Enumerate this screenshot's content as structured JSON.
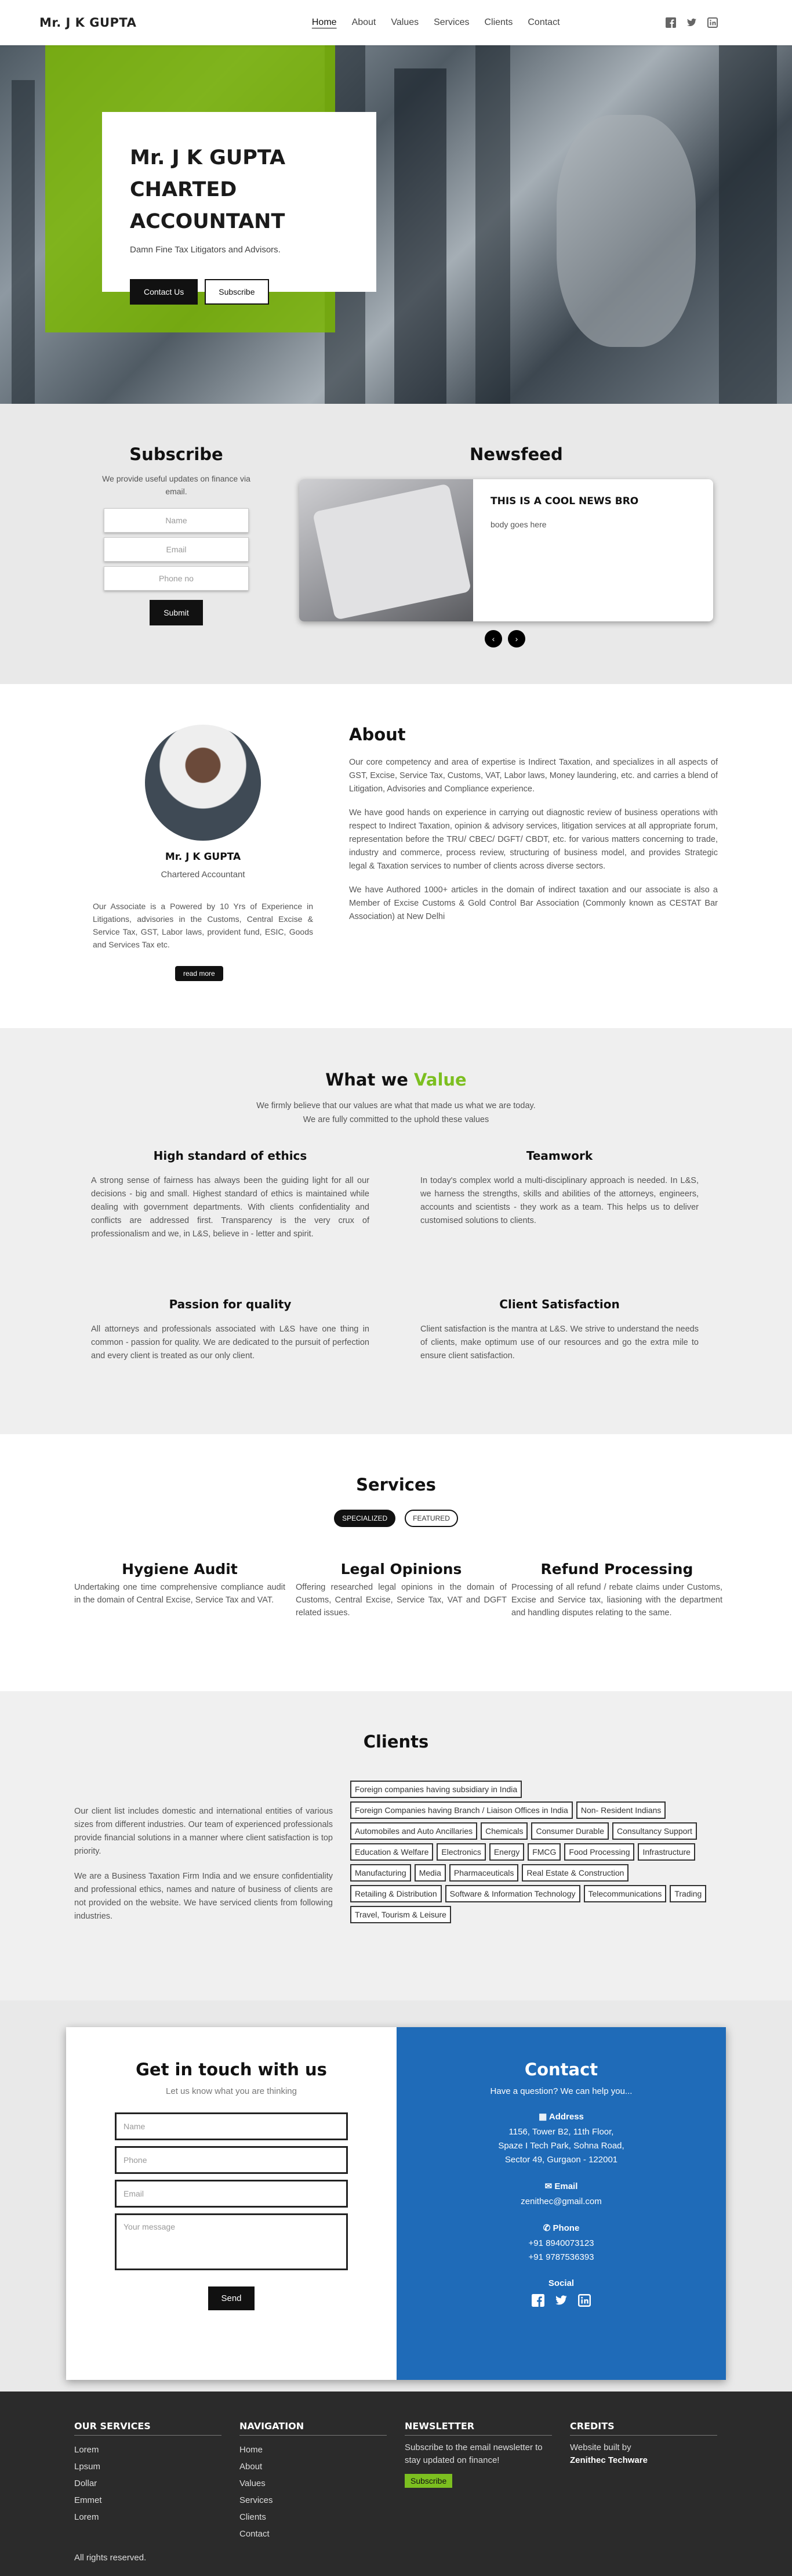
{
  "nav": {
    "brand": "Mr. J K GUPTA",
    "links": [
      "Home",
      "About",
      "Values",
      "Services",
      "Clients",
      "Contact"
    ],
    "social_icons": [
      "facebook-icon",
      "twitter-icon",
      "linkedin-icon"
    ]
  },
  "hero": {
    "title_line1": "Mr. J K GUPTA",
    "title_line2": "CHARTED ACCOUNTANT",
    "tagline": "Damn Fine Tax Litigators and Advisors.",
    "contact_button": "Contact Us",
    "subscribe_button": "Subscribe",
    "accent_color": "#7cbf20"
  },
  "subscribe": {
    "heading": "Subscribe",
    "text": "We provide useful updates on finance via email.",
    "name_placeholder": "Name",
    "email_placeholder": "Email",
    "phone_placeholder": "Phone no",
    "submit_label": "Submit"
  },
  "newsfeed": {
    "heading": "Newsfeed",
    "title": "THIS IS A COOL NEWS BRO",
    "body": "body goes here",
    "prev": "‹",
    "next": "›"
  },
  "about": {
    "name": "Mr. J K GUPTA",
    "role": "Chartered Accountant",
    "summary": "Our Associate is a Powered by 10 Yrs of Experience in Litigations, advisories in the Customs, Central Excise & Service Tax, GST, Labor laws, provident fund, ESIC, Goods and Services Tax etc.",
    "read_more": "read more",
    "heading": "About",
    "paragraphs": [
      "Our core competency and area of expertise is Indirect Taxation, and specializes in all aspects of GST, Excise, Service Tax, Customs, VAT, Labor laws, Money laundering, etc. and carries a blend of Litigation, Advisories and Compliance experience.",
      "We have good hands on experience in carrying out diagnostic review of business operations with respect to Indirect Taxation, opinion & advisory services, litigation services at all appropriate forum, representation before the TRU/ CBEC/ DGFT/ CBDT, etc. for various matters concerning to trade, industry and commerce, process review, structuring of business model, and provides Strategic legal & Taxation services to number of clients across diverse sectors.",
      "We have Authored 1000+ articles in the domain of indirect taxation and our associate is also a Member of Excise Customs & Gold Control Bar Association (Commonly known as CESTAT Bar Association) at New Delhi"
    ]
  },
  "values": {
    "heading_prefix": "What we",
    "heading_highlight": "Value",
    "intro_line1": "We firmly believe that our values are what that made us what we are today.",
    "intro_line2": "We are fully committed to the uphold these values",
    "items": [
      {
        "title": "High standard of ethics",
        "text": "A strong sense of fairness has always been the guiding light for all our decisions - big and small. Highest standard of ethics is maintained while dealing with government departments. With clients confidentiality and conflicts are addressed first. Transparency is the very crux of professionalism and we, in L&S, believe in - letter and spirit."
      },
      {
        "title": "Teamwork",
        "text": "In today's complex world a multi-disciplinary approach is needed. In L&S, we harness the strengths, skills and abilities of the attorneys, engineers, accounts and scientists - they work as a team. This helps us to deliver customised solutions to clients."
      },
      {
        "title": "Passion for quality",
        "text": "All attorneys and professionals associated with L&S have one thing in common - passion for quality. We are dedicated to the pursuit of perfection and every client is treated as our only client."
      },
      {
        "title": "Client Satisfaction",
        "text": "Client satisfaction is the mantra at L&S. We strive to understand the needs of clients, make optimum use of our resources and go the extra mile to ensure client satisfaction."
      }
    ]
  },
  "services": {
    "heading": "Services",
    "tab_specialized": "SPECIALIZED",
    "tab_featured": "FEATURED",
    "items": [
      {
        "title": "Hygiene Audit",
        "text": "Undertaking one time comprehensive compliance audit in the domain of Central Excise, Service Tax and VAT."
      },
      {
        "title": "Legal Opinions",
        "text": "Offering researched legal opinions in the domain of Customs, Central Excise, Service Tax, VAT and DGFT related issues."
      },
      {
        "title": "Refund Processing",
        "text": "Processing of all refund / rebate claims under Customs, Excise and Service tax, liasioning with the department and handling disputes relating to the same."
      }
    ]
  },
  "clients": {
    "heading": "Clients",
    "paragraph1": "Our client list includes domestic and international entities of various sizes from different industries. Our team of experienced professionals provide financial solutions in a manner where client satisfaction is top priority.",
    "paragraph2": "We are a Business Taxation Firm India and we ensure confidentiality and professional ethics, names and nature of business of clients are not provided on the website. We have serviced clients from following industries.",
    "tags": [
      "Foreign companies having subsidiary in India",
      "Foreign Companies having Branch / Liaison Offices in India",
      "Non- Resident Indians",
      "Automobiles and Auto Ancillaries",
      "Chemicals",
      "Consumer Durable",
      "Consultancy Support",
      "Education & Welfare",
      "Electronics",
      "Energy",
      "FMCG",
      "Food Processing",
      "Infrastructure",
      "Manufacturing",
      "Media",
      "Pharmaceuticals",
      "Real Estate & Construction",
      "Retailing & Distribution",
      "Software & Information Technology",
      "Telecommunications",
      "Trading",
      "Travel, Tourism & Leisure"
    ]
  },
  "contact": {
    "heading_left": "Get in touch with us",
    "sub_left": "Let us know what you are thinking",
    "name_placeholder": "Name",
    "phone_placeholder": "Phone",
    "email_placeholder": "Email",
    "message_placeholder": "Your message",
    "send_label": "Send",
    "heading_right": "Contact",
    "sub_right": "Have a question? We can help you...",
    "address_label": "Address",
    "address_lines": [
      "1156, Tower B2, 11th Floor,",
      "Spaze I Tech Park, Sohna Road,",
      "Sector 49, Gurgaon - 122001"
    ],
    "email_label": "Email",
    "email": "zenithec@gmail.com",
    "phone_label": "Phone",
    "phones": [
      "+91 8940073123",
      "+91 9787536393"
    ],
    "social_label": "Social",
    "panel_color": "#1f6bb8"
  },
  "footer": {
    "services_heading": "OUR SERVICES",
    "services_items": [
      "Lorem",
      "Lpsum",
      "Dollar",
      "Emmet",
      "Lorem"
    ],
    "nav_heading": "NAVIGATION",
    "nav_items": [
      "Home",
      "About",
      "Values",
      "Services",
      "Clients",
      "Contact"
    ],
    "newsletter_heading": "NEWSLETTER",
    "newsletter_text": "Subscribe to the email newsletter to stay updated on finance!",
    "newsletter_button": "Subscribe",
    "credits_heading": "CREDITS",
    "credits_text": "Website built by",
    "credits_name": "Zenithec Techware",
    "copyright": "All rights reserved."
  }
}
